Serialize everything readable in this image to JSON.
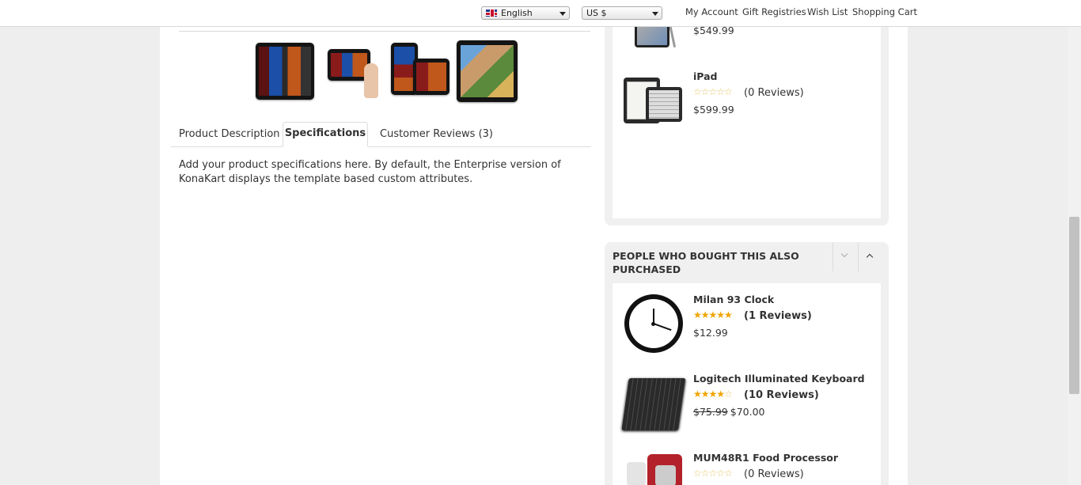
{
  "topbar": {
    "language": "English",
    "currency": "US $",
    "links": [
      "My Account",
      "Gift Registries",
      "Wish List",
      "Shopping Cart"
    ]
  },
  "product": {
    "thumbnails": [
      "kindle-fire-hd-thumb-1",
      "kindle-fire-hd-thumb-2",
      "kindle-fire-hd-thumb-3",
      "kindle-fire-hd-thumb-4"
    ],
    "tabs": [
      "Product Description",
      "Specifications",
      "Customer Reviews (3)"
    ],
    "active_tab": "Specifications",
    "spec_text": "Add your product specifications here. By default, the Enterprise version of KonaKart displays the template based custom attributes."
  },
  "sidebar_top": {
    "items": [
      {
        "name": "",
        "price": "$549.99"
      },
      {
        "name": "iPad",
        "rating": 0,
        "reviews": "(0 Reviews)",
        "price": "$599.99"
      }
    ]
  },
  "also_purchased": {
    "title": "PEOPLE WHO BOUGHT THIS ALSO PURCHASED",
    "items": [
      {
        "name": "Milan 93 Clock",
        "rating": 5,
        "reviews": "(1 Reviews)",
        "price": "$12.99"
      },
      {
        "name": "Logitech Illuminated Keyboard",
        "rating": 4,
        "reviews": "(10 Reviews)",
        "old_price": "$75.99",
        "price": "$70.00"
      },
      {
        "name": "MUM48R1 Food Processor",
        "rating": 0,
        "reviews": "(0 Reviews)"
      }
    ]
  },
  "colors": {
    "star": "#f0a400",
    "panel": "#f0f0f0",
    "background": "#eeeeee"
  }
}
